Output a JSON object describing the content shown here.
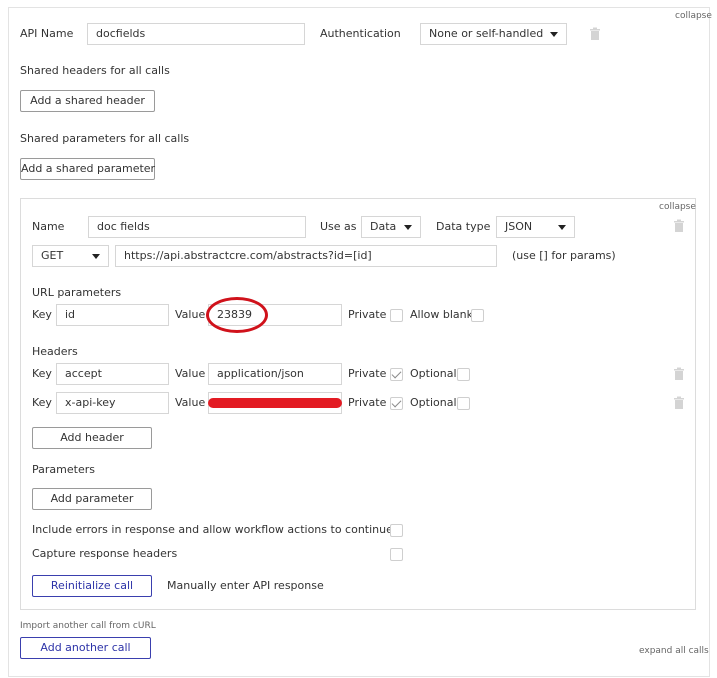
{
  "top": {
    "collapse_label": "collapse",
    "api_name_label": "API Name",
    "api_name_value": "docfields",
    "authentication_label": "Authentication",
    "authentication_value": "None or self-handled"
  },
  "shared": {
    "headers_title": "Shared headers for all calls",
    "add_header_button": "Add a shared header",
    "params_title": "Shared parameters for all calls",
    "add_param_button": "Add a shared parameter"
  },
  "call": {
    "collapse_label": "collapse",
    "name_label": "Name",
    "name_value": "doc fields",
    "use_as_label": "Use as",
    "use_as_value": "Data",
    "data_type_label": "Data type",
    "data_type_value": "JSON",
    "method_value": "GET",
    "url_value": "https://api.abstractcre.com/abstracts?id=[id]",
    "url_hint": "(use [] for params)",
    "url_params_title": "URL parameters",
    "url_params": [
      {
        "key_label": "Key",
        "key": "id",
        "value_label": "Value",
        "value": "23839",
        "private_label": "Private",
        "private": false,
        "allow_blank_label": "Allow blank",
        "allow_blank": false
      }
    ],
    "headers_title": "Headers",
    "headers": [
      {
        "key_label": "Key",
        "key": "accept",
        "value_label": "Value",
        "value": "application/json",
        "private_label": "Private",
        "private": true,
        "optional_label": "Optional",
        "optional": false
      },
      {
        "key_label": "Key",
        "key": "x-api-key",
        "value_label": "Value",
        "value": "",
        "private_label": "Private",
        "private": true,
        "optional_label": "Optional",
        "optional": false
      }
    ],
    "add_header_button": "Add header",
    "parameters_title": "Parameters",
    "add_parameter_button": "Add parameter",
    "include_errors_label": "Include errors in response and allow workflow actions to continue",
    "include_errors": false,
    "capture_headers_label": "Capture response headers",
    "capture_headers": false,
    "reinitialize_button": "Reinitialize call",
    "manual_response_link": "Manually enter API response"
  },
  "footer": {
    "import_label": "Import another call from cURL",
    "add_call_button": "Add another call",
    "expand_all_label": "expand all calls"
  },
  "colors": {
    "annotation_red": "#d0121b",
    "redaction_red": "#e31b23",
    "primary_blue": "#2d33a8"
  },
  "icons": [
    "trash-icon",
    "chevron-down-icon",
    "checkmark-icon"
  ]
}
